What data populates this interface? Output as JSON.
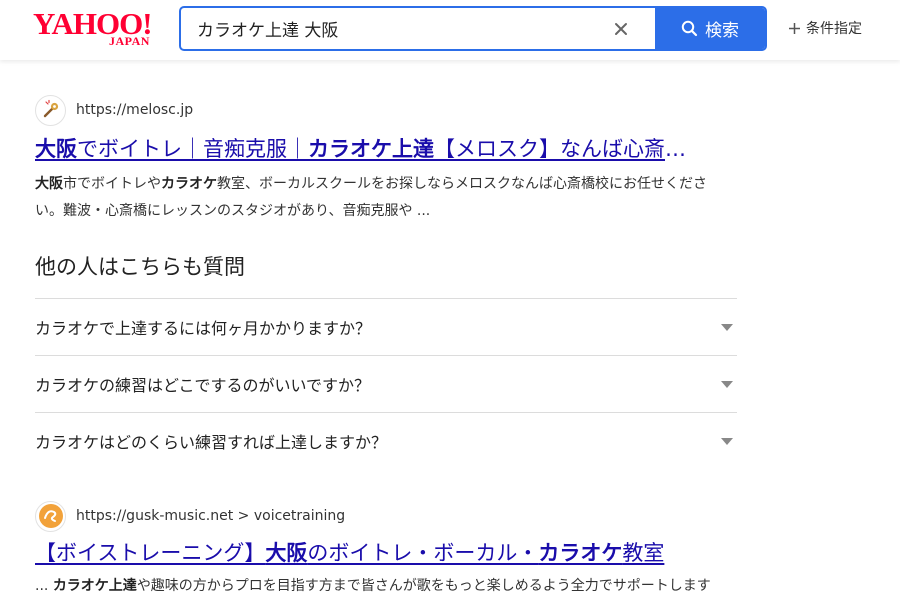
{
  "header": {
    "logo_main": "YAHOO!",
    "logo_sub": "JAPAN",
    "search_query": "カラオケ上達 大阪",
    "search_button": "検索",
    "conditions_label": "条件指定",
    "accent_color": "#2c6ee8",
    "logo_color": "#ff0033"
  },
  "results": [
    {
      "favicon": "microphone-icon",
      "url": "https://melosc.jp",
      "title_parts": [
        "大阪",
        "でボイトレ｜音痴克服｜",
        "カラオケ上達",
        "【メロスク】なんば心斎橋校"
      ],
      "snippet_parts": [
        "大阪",
        "市でボイトレや",
        "カラオケ",
        "教室、ボーカルスクールをお探しならメロスクなんば心斎橋校にお任せください。難波・心斎橋にレッスンのスタジオがあり、音痴克服や ..."
      ]
    },
    {
      "favicon": "gusk-logo-icon",
      "url": "https://gusk-music.net > voicetraining",
      "title_parts": [
        "【ボイストレーニング】",
        "大阪",
        "のボイトレ・ボーカル・",
        "カラオケ",
        "教室"
      ],
      "snippet_parts": [
        "... ",
        "カラオケ上達",
        "や趣味の方からプロを目指す方まで皆さんが歌をもっと楽しめるよう全力でサポートします"
      ]
    }
  ],
  "people_also_ask": {
    "heading": "他の人はこちらも質問",
    "questions": [
      "カラオケで上達するには何ヶ月かかりますか？",
      "カラオケの練習はどこでするのがいいですか？",
      "カラオケはどのくらい練習すれば上達しますか？"
    ]
  }
}
